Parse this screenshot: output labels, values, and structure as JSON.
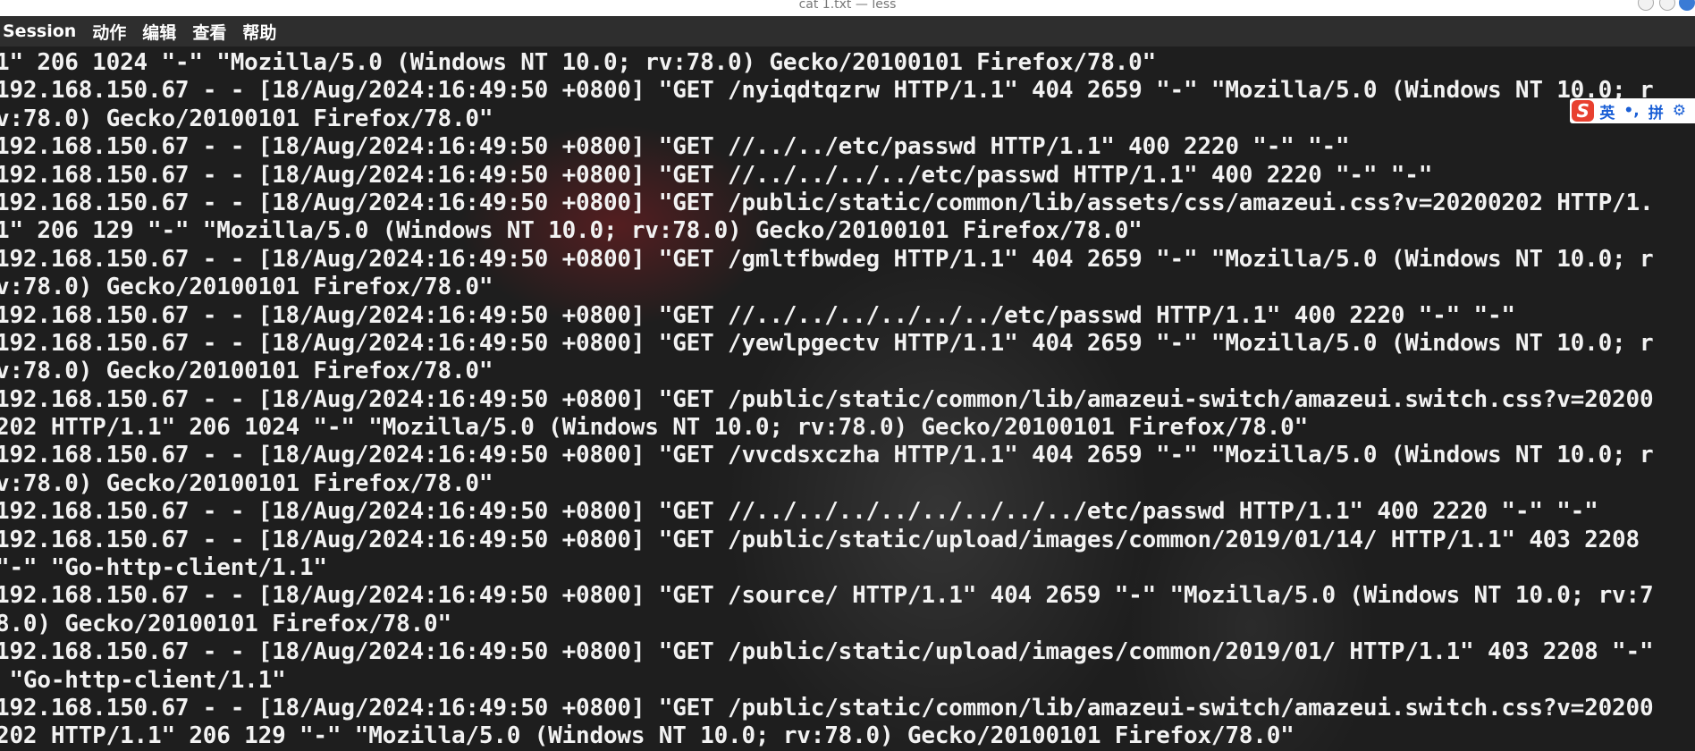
{
  "window": {
    "title": "cat 1.txt — less"
  },
  "menubar": {
    "items": [
      "Session",
      "动作",
      "编辑",
      "查看",
      "帮助"
    ]
  },
  "terminal": {
    "lines": [
      "1\" 206 1024 \"-\" \"Mozilla/5.0 (Windows NT 10.0; rv:78.0) Gecko/20100101 Firefox/78.0\"",
      "192.168.150.67 - - [18/Aug/2024:16:49:50 +0800] \"GET /nyiqdtqzrw HTTP/1.1\" 404 2659 \"-\" \"Mozilla/5.0 (Windows NT 10.0; r",
      "v:78.0) Gecko/20100101 Firefox/78.0\"",
      "192.168.150.67 - - [18/Aug/2024:16:49:50 +0800] \"GET //../../etc/passwd HTTP/1.1\" 400 2220 \"-\" \"-\"",
      "192.168.150.67 - - [18/Aug/2024:16:49:50 +0800] \"GET //../../../../etc/passwd HTTP/1.1\" 400 2220 \"-\" \"-\"",
      "192.168.150.67 - - [18/Aug/2024:16:49:50 +0800] \"GET /public/static/common/lib/assets/css/amazeui.css?v=20200202 HTTP/1.",
      "1\" 206 129 \"-\" \"Mozilla/5.0 (Windows NT 10.0; rv:78.0) Gecko/20100101 Firefox/78.0\"",
      "192.168.150.67 - - [18/Aug/2024:16:49:50 +0800] \"GET /gmltfbwdeg HTTP/1.1\" 404 2659 \"-\" \"Mozilla/5.0 (Windows NT 10.0; r",
      "v:78.0) Gecko/20100101 Firefox/78.0\"",
      "192.168.150.67 - - [18/Aug/2024:16:49:50 +0800] \"GET //../../../../../../etc/passwd HTTP/1.1\" 400 2220 \"-\" \"-\"",
      "192.168.150.67 - - [18/Aug/2024:16:49:50 +0800] \"GET /yewlpgectv HTTP/1.1\" 404 2659 \"-\" \"Mozilla/5.0 (Windows NT 10.0; r",
      "v:78.0) Gecko/20100101 Firefox/78.0\"",
      "192.168.150.67 - - [18/Aug/2024:16:49:50 +0800] \"GET /public/static/common/lib/amazeui-switch/amazeui.switch.css?v=20200",
      "202 HTTP/1.1\" 206 1024 \"-\" \"Mozilla/5.0 (Windows NT 10.0; rv:78.0) Gecko/20100101 Firefox/78.0\"",
      "192.168.150.67 - - [18/Aug/2024:16:49:50 +0800] \"GET /vvcdsxczha HTTP/1.1\" 404 2659 \"-\" \"Mozilla/5.0 (Windows NT 10.0; r",
      "v:78.0) Gecko/20100101 Firefox/78.0\"",
      "192.168.150.67 - - [18/Aug/2024:16:49:50 +0800] \"GET //../../../../../../../../etc/passwd HTTP/1.1\" 400 2220 \"-\" \"-\"",
      "192.168.150.67 - - [18/Aug/2024:16:49:50 +0800] \"GET /public/static/upload/images/common/2019/01/14/ HTTP/1.1\" 403 2208",
      "\"-\" \"Go-http-client/1.1\"",
      "192.168.150.67 - - [18/Aug/2024:16:49:50 +0800] \"GET /source/ HTTP/1.1\" 404 2659 \"-\" \"Mozilla/5.0 (Windows NT 10.0; rv:7",
      "8.0) Gecko/20100101 Firefox/78.0\"",
      "192.168.150.67 - - [18/Aug/2024:16:49:50 +0800] \"GET /public/static/upload/images/common/2019/01/ HTTP/1.1\" 403 2208 \"-\"",
      " \"Go-http-client/1.1\"",
      "192.168.150.67 - - [18/Aug/2024:16:49:50 +0800] \"GET /public/static/common/lib/amazeui-switch/amazeui.switch.css?v=20200",
      "202 HTTP/1.1\" 206 129 \"-\" \"Mozilla/5.0 (Windows NT 10.0; rv:78.0) Gecko/20100101 Firefox/78.0\""
    ]
  },
  "ime_toolbar": {
    "logo": "S",
    "mode": "英",
    "punct": "•,",
    "input": "拼",
    "settings_icon": "gear-icon"
  }
}
